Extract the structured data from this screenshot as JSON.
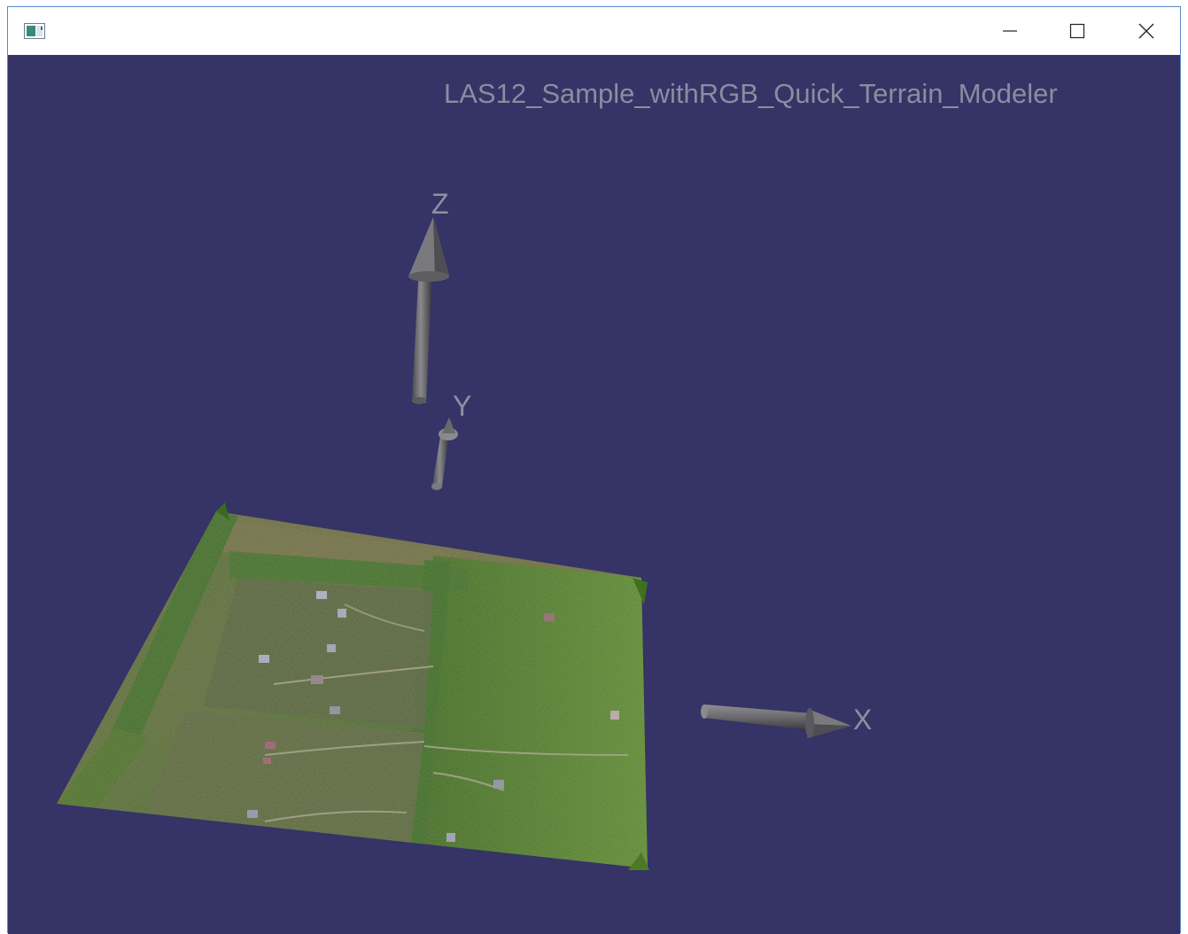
{
  "window": {
    "title": "",
    "controls": {
      "minimize": "minimize-icon",
      "maximize": "maximize-icon",
      "close": "close-icon"
    }
  },
  "scene": {
    "title": "LAS12_Sample_withRGB_Quick_Terrain_Modeler",
    "background_color": "#363366",
    "axes": {
      "x_label": "X",
      "y_label": "Y",
      "z_label": "Z",
      "arrow_color": "#6e6e72"
    },
    "terrain": {
      "description_icon": "terrain-point-cloud"
    }
  }
}
